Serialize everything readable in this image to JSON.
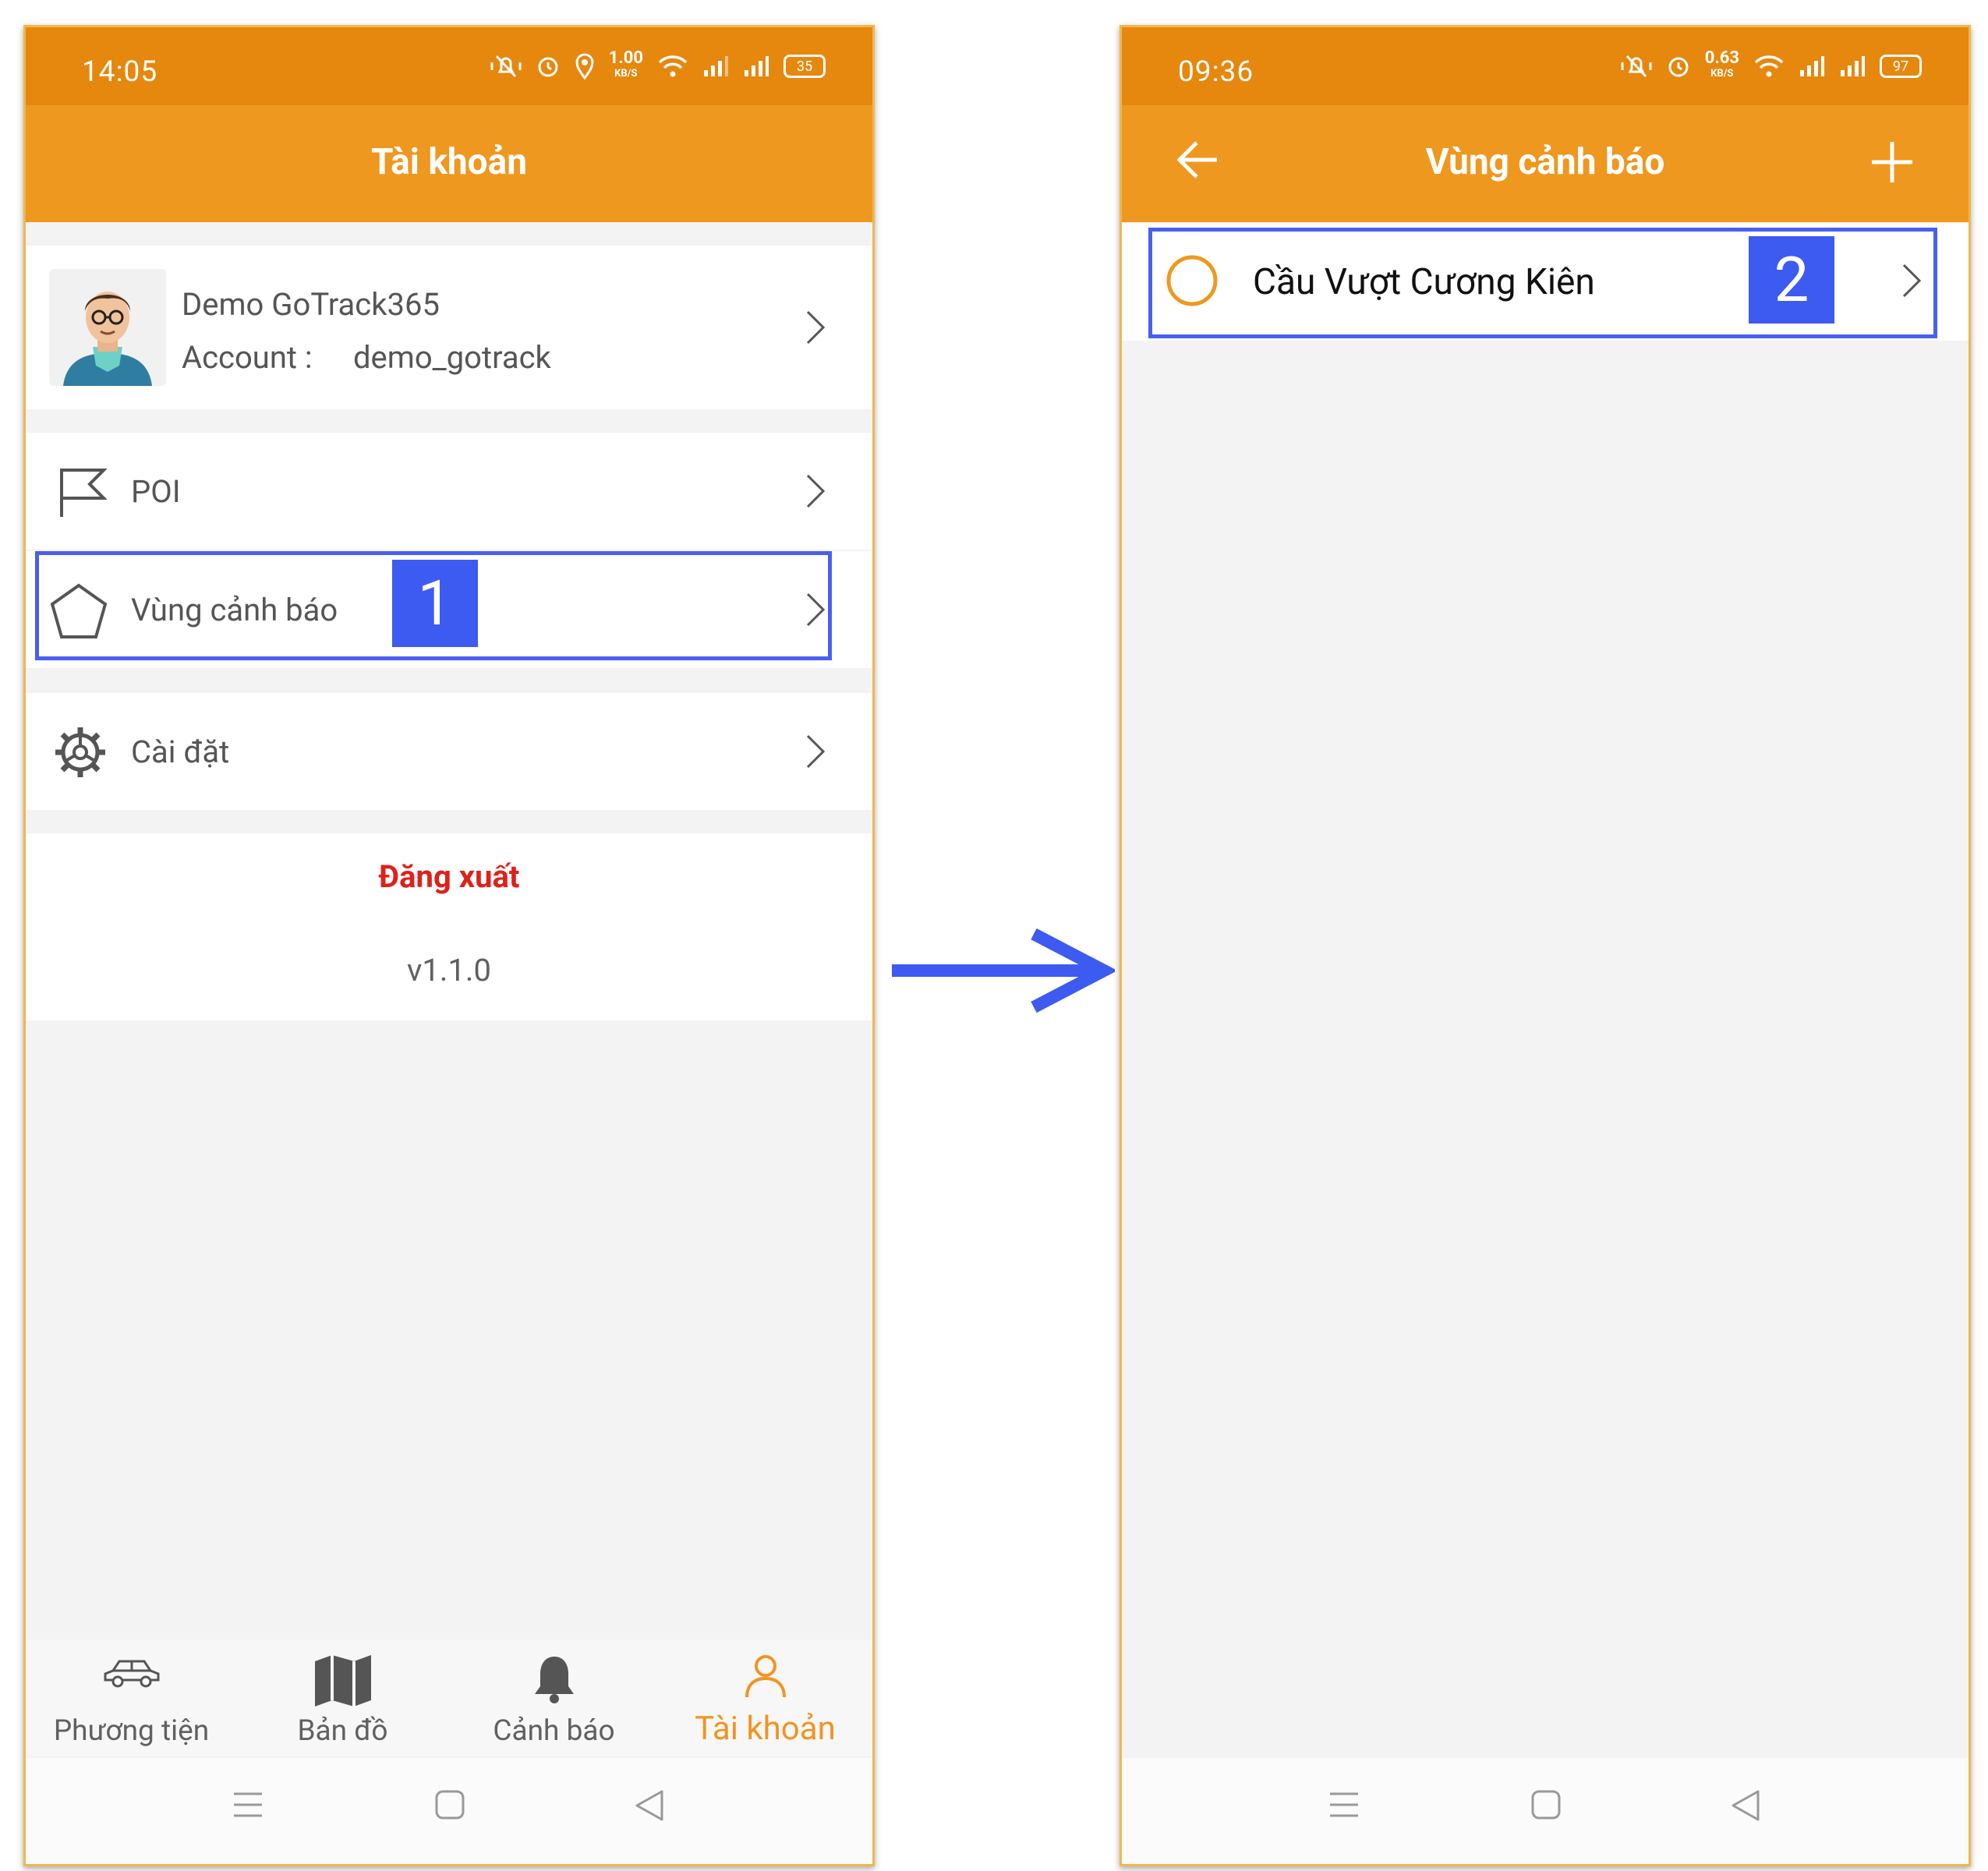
{
  "left": {
    "status_time": "14:05",
    "net_speed": "1.00",
    "net_unit": "KB/S",
    "battery": "35",
    "title": "Tài khoản",
    "profile": {
      "name": "Demo GoTrack365",
      "account_label": "Account :",
      "account_value": "demo_gotrack"
    },
    "menu": {
      "poi": "POI",
      "zone": "Vùng cảnh báo",
      "settings": "Cài đặt"
    },
    "logout": "Đăng xuất",
    "version": "v1.1.0",
    "badge": "1",
    "nav": [
      {
        "label": "Phương tiện",
        "icon": "car-icon"
      },
      {
        "label": "Bản đồ",
        "icon": "map-icon"
      },
      {
        "label": "Cảnh báo",
        "icon": "bell-icon"
      },
      {
        "label": "Tài khoản",
        "icon": "user-icon",
        "active": true
      }
    ],
    "active_color": "#f29422"
  },
  "right": {
    "status_time": "09:36",
    "net_speed": "0.63",
    "net_unit": "KB/S",
    "battery": "97",
    "title": "Vùng cảnh báo",
    "zone_item": "Cầu Vượt Cương Kiên",
    "badge": "2"
  },
  "colors": {
    "statusbar": "#e6870e",
    "appbar": "#ef981f",
    "highlight": "#4a5ff0",
    "badge": "#3d5af1",
    "logout": "#e0201a"
  }
}
